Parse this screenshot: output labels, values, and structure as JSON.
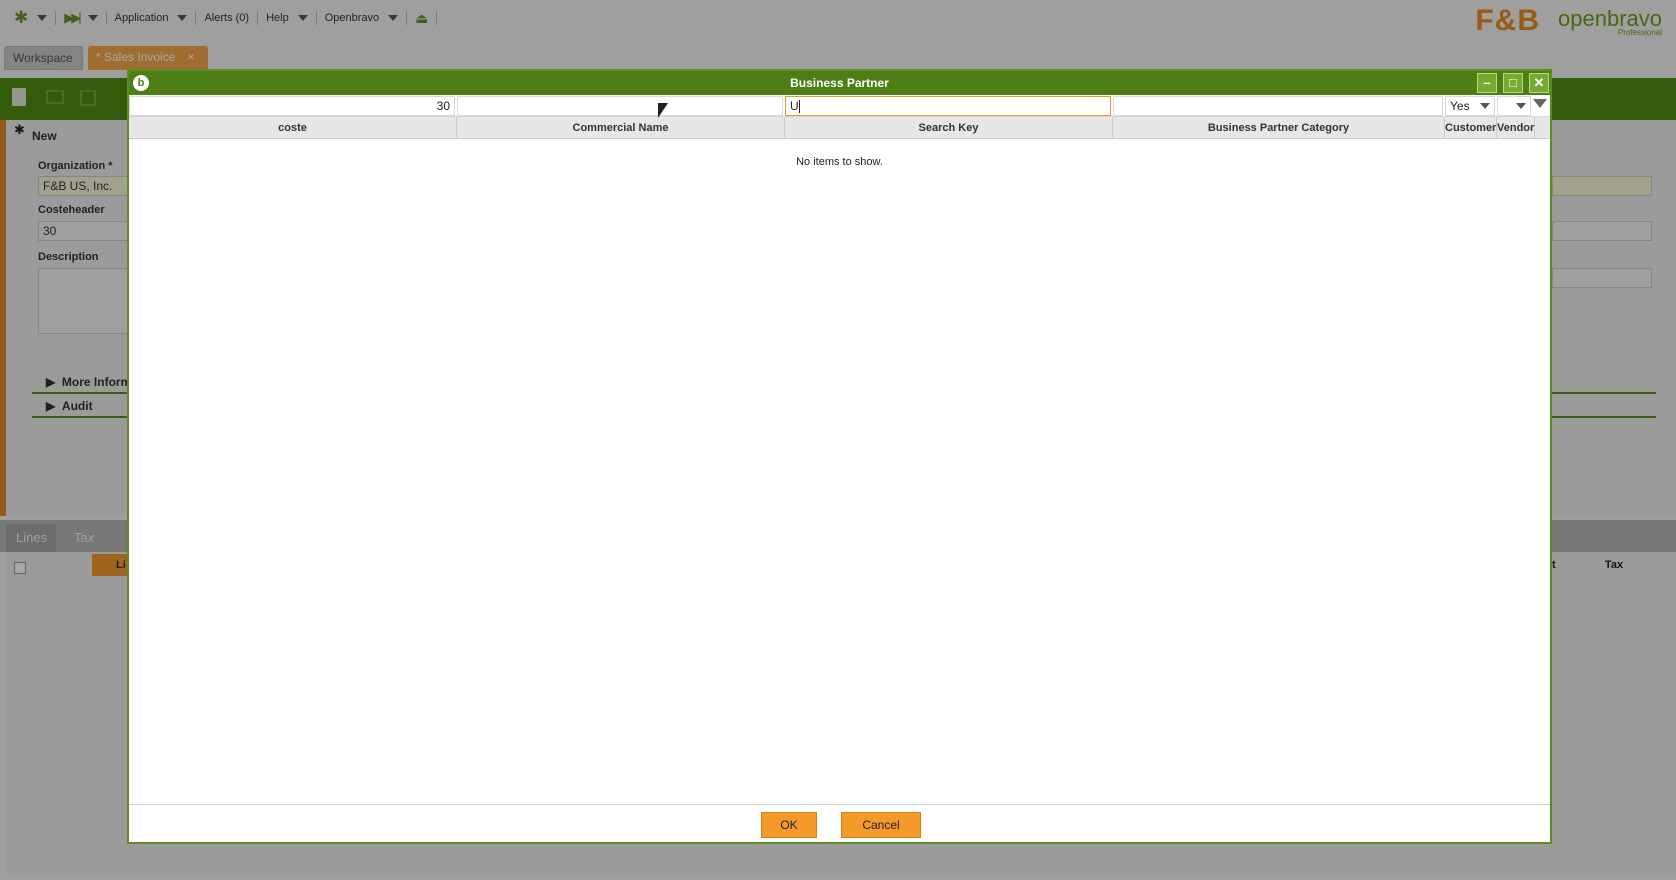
{
  "topbar": {
    "application_label": "Application",
    "alerts_label": "Alerts (0)",
    "help_label": "Help",
    "user_label": "Openbravo"
  },
  "logo": {
    "fb": "F&B",
    "brand": "openbravo",
    "edition": "Professional"
  },
  "tabs": [
    {
      "label": "Workspace"
    },
    {
      "label": "* Sales Invoice"
    }
  ],
  "form": {
    "new_label": "New",
    "organization_label": "Organization *",
    "organization_value": "F&B US, Inc.",
    "costeheader_label": "Costeheader",
    "costeheader_value": "30",
    "description_label": "Description",
    "more_info_label": "More Inform",
    "audit_label": "Audit"
  },
  "lower_tabs": [
    {
      "label": "Lines"
    },
    {
      "label": "Tax"
    }
  ],
  "lines_grid": {
    "col_partial": "Li",
    "col_tax": "Tax",
    "col_t": "t"
  },
  "dialog": {
    "title": "Business Partner",
    "filters": {
      "coste": "30",
      "commercial_name": "",
      "search_key": "U",
      "category": "",
      "customer": "Yes",
      "vendor": ""
    },
    "columns": [
      "coste",
      "Commercial Name",
      "Search Key",
      "Business Partner Category",
      "Customer",
      "Vendor"
    ],
    "empty_message": "No items to show.",
    "ok_label": "OK",
    "cancel_label": "Cancel"
  },
  "colors": {
    "accent_green": "#4d7f14",
    "accent_orange": "#f39a2b"
  }
}
